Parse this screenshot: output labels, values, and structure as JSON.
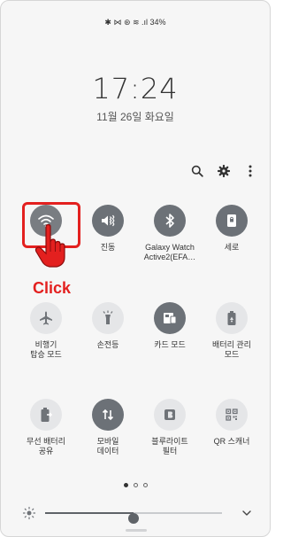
{
  "status_bar": {
    "text": "✱ ⋈ ⊛ ≋ .ıl 34%"
  },
  "clock": {
    "time": "17:24",
    "date": "11월 26일 화요일"
  },
  "toolbar": {
    "icons": [
      "search-icon",
      "settings-icon",
      "more-icon"
    ]
  },
  "tiles": [
    {
      "label": "",
      "icon": "wifi-icon",
      "state": "on"
    },
    {
      "label": "진동",
      "icon": "vibrate-icon",
      "state": "on"
    },
    {
      "label": "Galaxy Watch\nActive2(EFA…",
      "icon": "bluetooth-icon",
      "state": "on"
    },
    {
      "label": "세로",
      "icon": "portrait-lock-icon",
      "state": "on"
    },
    {
      "label": "비행기\n탑승 모드",
      "icon": "airplane-icon",
      "state": "off"
    },
    {
      "label": "손전등",
      "icon": "flashlight-icon",
      "state": "off"
    },
    {
      "label": "카드 모드",
      "icon": "card-mode-icon",
      "state": "on"
    },
    {
      "label": "배터리 관리\n모드",
      "icon": "battery-saver-icon",
      "state": "off"
    },
    {
      "label": "무선 배터리\n공유",
      "icon": "wireless-share-icon",
      "state": "off"
    },
    {
      "label": "모바일\n데이터",
      "icon": "mobile-data-icon",
      "state": "on"
    },
    {
      "label": "블루라이트\n필터",
      "icon": "blue-light-icon",
      "state": "off"
    },
    {
      "label": "QR 스캐너",
      "icon": "qr-scanner-icon",
      "state": "off"
    }
  ],
  "annotation": {
    "click_text": "Click",
    "color": "#e3201f"
  },
  "pager": {
    "pages": 3,
    "current": 1
  },
  "brightness": {
    "level": 0.5
  },
  "colors": {
    "tile_on": "#72767c",
    "tile_off": "#e5e6e8",
    "text": "#333333"
  }
}
